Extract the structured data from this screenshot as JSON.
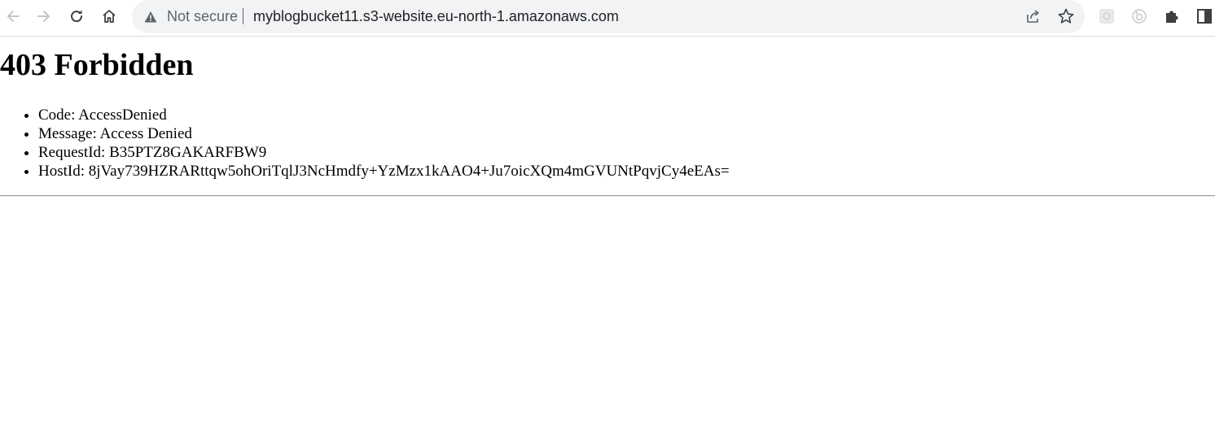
{
  "browser": {
    "security_label": "Not secure",
    "url": "myblogbucket11.s3-website.eu-north-1.amazonaws.com",
    "icons": {
      "back": "arrow-left-icon",
      "forward": "arrow-right-icon",
      "reload": "reload-icon",
      "home": "home-icon",
      "warning": "warning-triangle-icon",
      "share": "share-icon",
      "bookmark": "star-icon",
      "extension_a": "extension-icon",
      "extension_b": "extension-icon",
      "extensions": "puzzle-icon",
      "side_panel": "side-panel-icon"
    },
    "colors": {
      "omnibox_bg": "#f1f3f4",
      "icon": "#5f6368",
      "icon_disabled": "#c4c7c5"
    }
  },
  "page": {
    "heading": "403 Forbidden",
    "details": [
      {
        "text": "Code: AccessDenied"
      },
      {
        "text": "Message: Access Denied"
      },
      {
        "text": "RequestId: B35PTZ8GAKARFBW9"
      },
      {
        "text": "HostId: 8jVay739HZRARttqw5ohOriTqlJ3NcHmdfy+YzMzx1kAAO4+Ju7oicXQm4mGVUNtPqvjCy4eEAs="
      }
    ]
  }
}
